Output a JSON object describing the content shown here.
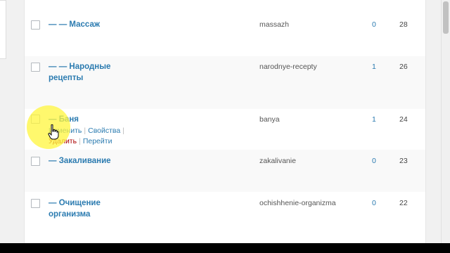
{
  "rows": [
    {
      "name": "— — Массаж",
      "slug": "massazh",
      "description": "0",
      "count": "28"
    },
    {
      "name": "— — Народные рецепты",
      "slug": "narodnye-recepty",
      "description": "1",
      "count": "26"
    },
    {
      "name": "— Баня",
      "slug": "banya",
      "description": "1",
      "count": "24",
      "actions": {
        "edit": "Изменить",
        "quick_edit": "Свойства",
        "delete": "Удалить",
        "view": "Перейти"
      }
    },
    {
      "name": "— Закаливание",
      "slug": "zakalivanie",
      "description": "0",
      "count": "23"
    },
    {
      "name": "— Очищение организма",
      "slug": "ochishhenie-organizma",
      "description": "0",
      "count": "22"
    }
  ],
  "colors": {
    "link": "#2b7bb0",
    "delete": "#a00000",
    "highlight": "#fff53c"
  }
}
